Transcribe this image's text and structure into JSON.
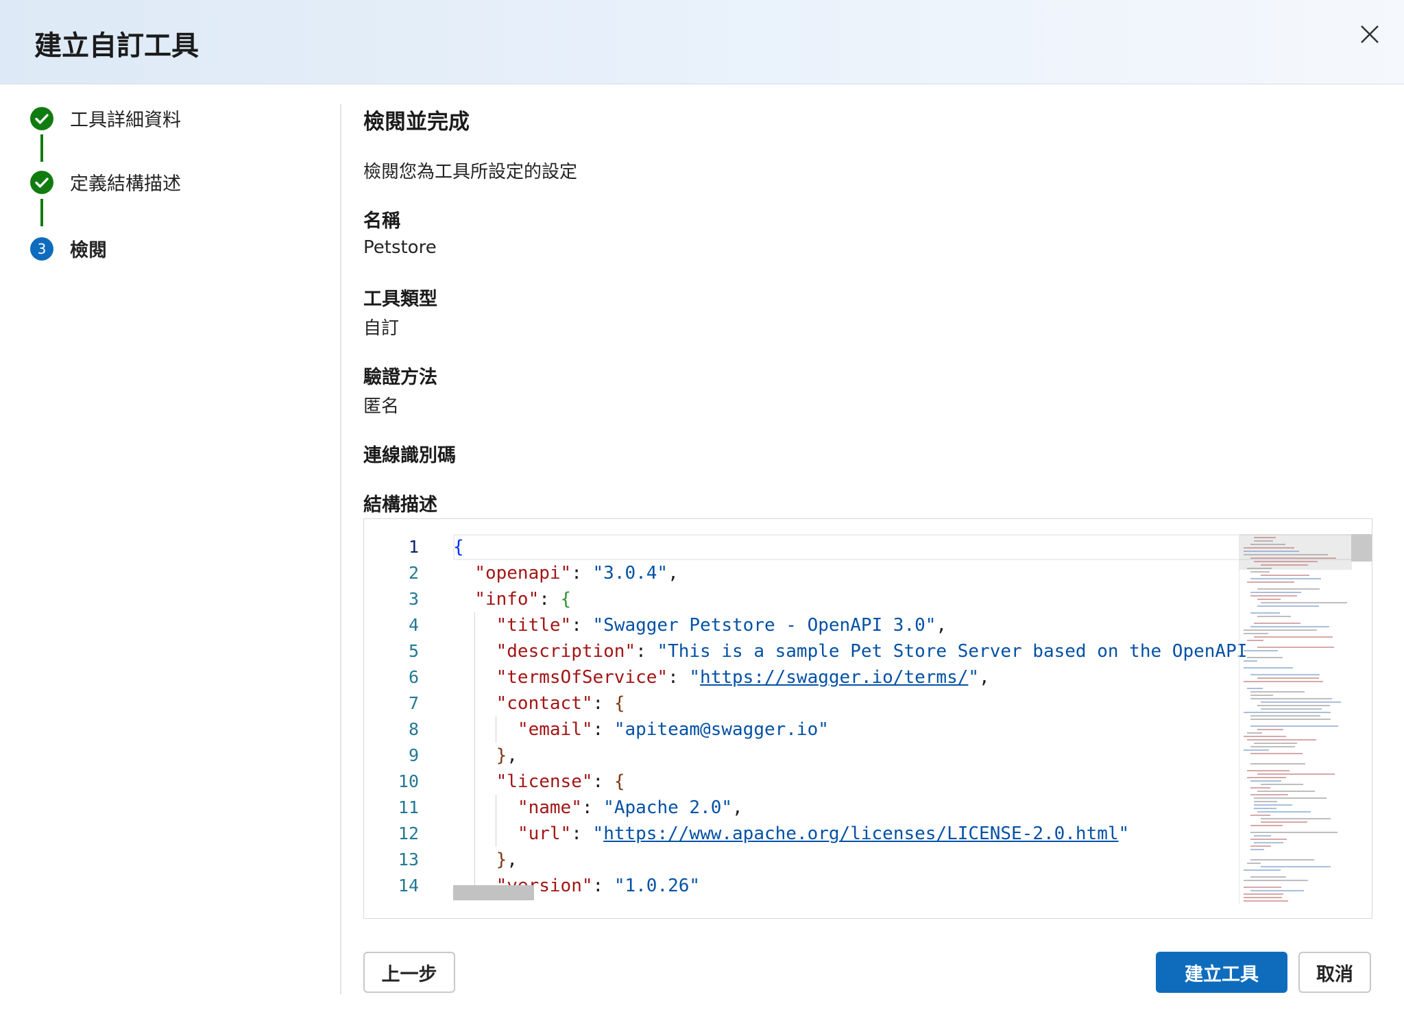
{
  "dialog": {
    "title": "建立自訂工具",
    "close_icon": "close-icon"
  },
  "steps": [
    {
      "label": "工具詳細資料",
      "status": "complete",
      "icon": "checkmark-icon"
    },
    {
      "label": "定義結構描述",
      "status": "complete",
      "icon": "checkmark-icon"
    },
    {
      "label": "檢閱",
      "status": "current",
      "number": "3"
    }
  ],
  "review": {
    "title": "檢閱並完成",
    "subtitle": "檢閱您為工具所設定的設定",
    "fields": [
      {
        "label": "名稱",
        "value": "Petstore"
      },
      {
        "label": "工具類型",
        "value": "自訂"
      },
      {
        "label": "驗證方法",
        "value": "匿名"
      },
      {
        "label": "連線識別碼",
        "value": ""
      }
    ],
    "schema_label": "結構描述"
  },
  "editor": {
    "line_numbers": [
      "1",
      "2",
      "3",
      "4",
      "5",
      "6",
      "7",
      "8",
      "9",
      "10",
      "11",
      "12",
      "13",
      "14"
    ],
    "lines": [
      "{",
      "  \"openapi\": \"3.0.4\",",
      "  \"info\": {",
      "    \"title\": \"Swagger Petstore - OpenAPI 3.0\",",
      "    \"description\": \"This is a sample Pet Store Server based on the OpenAPI",
      "    \"termsOfService\": \"https://swagger.io/terms/\",",
      "    \"contact\": {",
      "      \"email\": \"apiteam@swagger.io\"",
      "    },",
      "    \"license\": {",
      "      \"name\": \"Apache 2.0\",",
      "      \"url\": \"https://www.apache.org/licenses/LICENSE-2.0.html\"",
      "    },",
      "    \"version\": \"1.0.26\""
    ]
  },
  "footer": {
    "back_label": "上一步",
    "create_label": "建立工具",
    "cancel_label": "取消"
  },
  "colors": {
    "accent": "#0f6cbd",
    "success": "#107c10",
    "json_key": "#a31515",
    "json_string": "#0451a5"
  }
}
